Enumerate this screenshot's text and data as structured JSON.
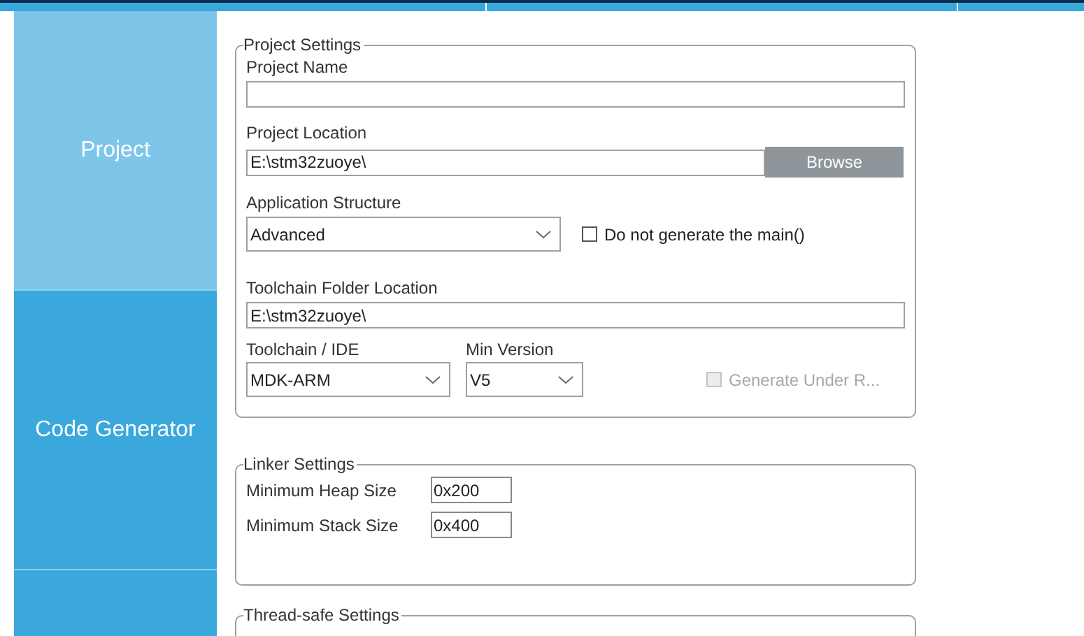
{
  "sidebar": {
    "tabs": [
      {
        "label": "Project",
        "selected": true
      },
      {
        "label": "Code Generator",
        "selected": false
      }
    ]
  },
  "project_settings": {
    "title": "Project Settings",
    "project_name": {
      "label": "Project Name"
    },
    "project_location": {
      "label": "Project Location",
      "value": "E:\\stm32zuoye\\",
      "button": "Browse"
    },
    "application_structure": {
      "label": "Application Structure",
      "value": "Advanced"
    },
    "main_option": {
      "label": "Do not generate the main()",
      "checked": false,
      "disabled": false
    },
    "toolchain_folder": {
      "label": "Toolchain Folder Location",
      "value": "E:\\stm32zuoye\\"
    },
    "toolchain": {
      "label": "Toolchain / IDE",
      "value": "MDK-ARM"
    },
    "min_version": {
      "label": "Min Version",
      "value": "V5"
    },
    "root_option": {
      "label": "Generate Under R...",
      "checked": false,
      "disabled": true
    }
  },
  "linker_settings": {
    "title": "Linker Settings",
    "fields": [
      {
        "label": "Minimum Heap Size",
        "value": "0x200"
      },
      {
        "label": "Minimum Stack Size",
        "value": "0x400"
      }
    ]
  },
  "thread_safe_settings": {
    "title": "Thread-safe Settings"
  }
}
